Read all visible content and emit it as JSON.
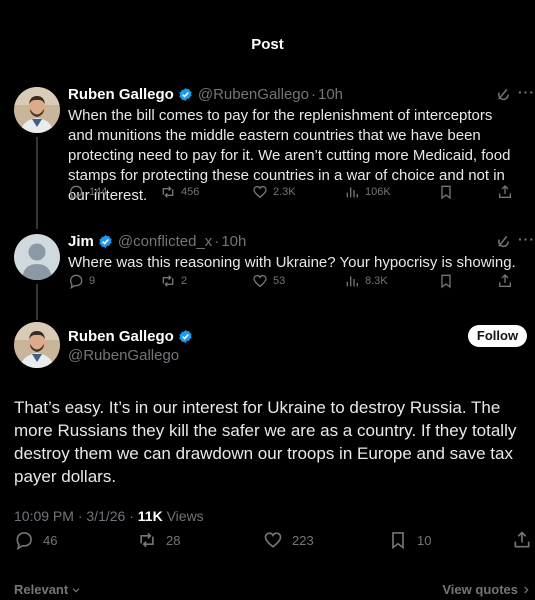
{
  "page": {
    "title": "Post"
  },
  "reply1": {
    "name": "Ruben Gallego",
    "handle": "@RubenGallego",
    "sep": "·",
    "time": "10h",
    "text": "When the bill comes to pay for the replenishment of interceptors and munitions the middle eastern countries that we have been protecting need to pay for it. We aren’t cutting more Medicaid, food stamps for protecting these countries in a war of choice and not in our interest.",
    "stats": {
      "replies": "144",
      "reposts": "456",
      "likes": "2.3K",
      "views": "106K"
    }
  },
  "reply2": {
    "name": "Jim",
    "handle": "@conflicted_x",
    "sep": "·",
    "time": "10h",
    "text": "Where was this reasoning with Ukraine?  Your hypocrisy is showing.",
    "stats": {
      "replies": "9",
      "reposts": "2",
      "likes": "53",
      "views": "8.3K"
    }
  },
  "main": {
    "name": "Ruben Gallego",
    "handle": "@RubenGallego",
    "follow_label": "Follow",
    "text": "That’s easy. It’s in our interest for Ukraine to destroy Russia.  The more Russians they kill the safer we are as a country.  If they totally destroy them we can drawdown our troops in Europe and save tax payer dollars.",
    "time": "10:09 PM",
    "date": "3/1/26",
    "views_count": "11K",
    "views_label": "Views",
    "stats": {
      "replies": "46",
      "reposts": "28",
      "likes": "223",
      "bookmarks": "10"
    }
  },
  "footer": {
    "relevant": "Relevant",
    "view_quotes": "View quotes"
  },
  "colors": {
    "background": "#000000",
    "muted": "#71767b",
    "verified": "#1d9bf0",
    "text": "#e7e9ea"
  }
}
